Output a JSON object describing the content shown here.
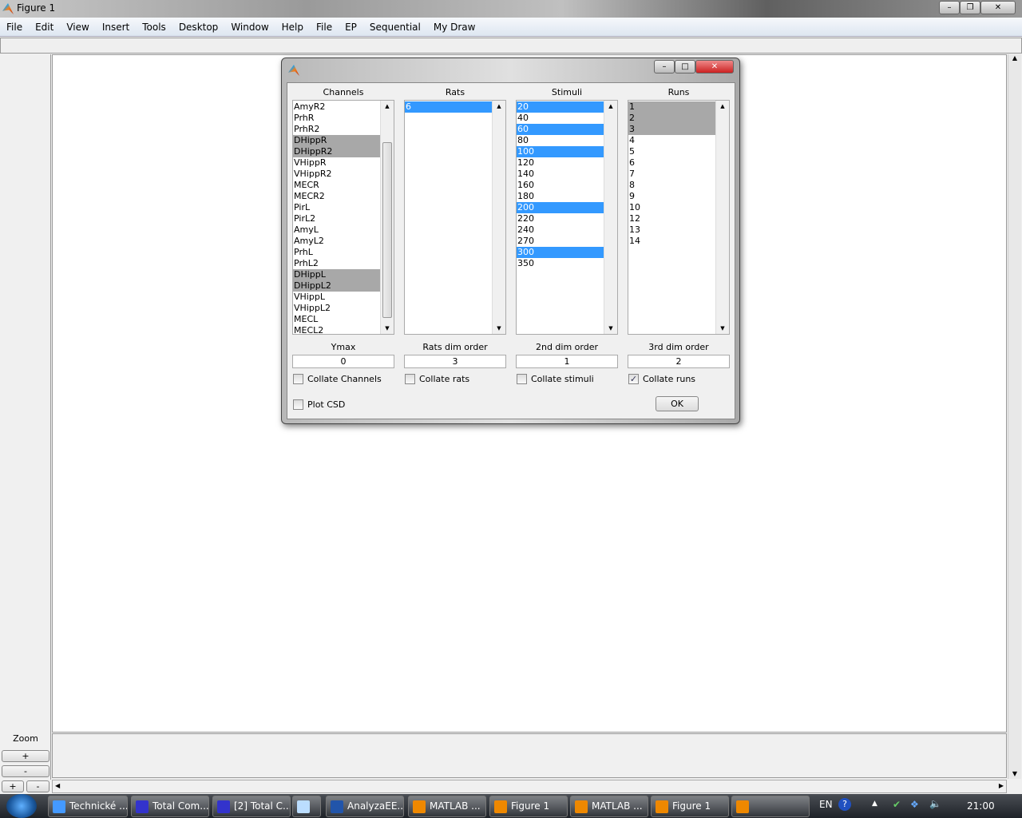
{
  "window": {
    "title": "Figure 1"
  },
  "menu": [
    "File",
    "Edit",
    "View",
    "Insert",
    "Tools",
    "Desktop",
    "Window",
    "Help",
    "File",
    "EP",
    "Sequential",
    "My Draw"
  ],
  "zoom_panel": {
    "label": "Zoom",
    "plus": "+",
    "minus": "-",
    "plus2": "+",
    "minus2": "-"
  },
  "dialog": {
    "lists": [
      {
        "label": "Channels",
        "items": [
          "AmyR2",
          "PrhR",
          "PrhR2",
          "DHippR",
          "DHippR2",
          "VHippR",
          "VHippR2",
          "MECR",
          "MECR2",
          "PirL",
          "PirL2",
          "AmyL",
          "AmyL2",
          "PrhL",
          "PrhL2",
          "DHippL",
          "DHippL2",
          "VHippL",
          "VHippL2",
          "MECL",
          "MECL2"
        ],
        "selected": [
          "DHippR",
          "DHippR2",
          "DHippL",
          "DHippL2"
        ],
        "selection_style": "inactive"
      },
      {
        "label": "Rats",
        "items": [
          "6"
        ],
        "selected": [
          "6"
        ],
        "selection_style": "active"
      },
      {
        "label": "Stimuli",
        "items": [
          "20",
          "40",
          "60",
          "80",
          "100",
          "120",
          "140",
          "160",
          "180",
          "200",
          "220",
          "240",
          "270",
          "300",
          "350"
        ],
        "selected": [
          "20",
          "60",
          "100",
          "200",
          "300"
        ],
        "selection_style": "active"
      },
      {
        "label": "Runs",
        "items": [
          "1",
          "2",
          "3",
          "4",
          "5",
          "6",
          "7",
          "8",
          "9",
          "10",
          "12",
          "13",
          "14"
        ],
        "selected": [
          "1",
          "2",
          "3"
        ],
        "selection_style": "inactive"
      }
    ],
    "fields": [
      {
        "label": "Ymax",
        "value": "0"
      },
      {
        "label": "Rats dim order",
        "value": "3"
      },
      {
        "label": "2nd dim order",
        "value": "1"
      },
      {
        "label": "3rd dim order",
        "value": "2"
      }
    ],
    "checkboxes": [
      {
        "label": "Collate Channels",
        "checked": false
      },
      {
        "label": "Collate rats",
        "checked": false
      },
      {
        "label": "Collate stimuli",
        "checked": false
      },
      {
        "label": "Collate runs",
        "checked": true
      }
    ],
    "plot_csd": {
      "label": "Plot CSD",
      "checked": false
    },
    "ok": "OK",
    "colors": {
      "active_selection": "#3399ff",
      "inactive_selection": "#a8a8a8"
    }
  },
  "taskbar": {
    "items": [
      {
        "label": "Technické ...",
        "icon": "ie-icon"
      },
      {
        "label": "Total Com...",
        "icon": "floppy-icon"
      },
      {
        "label": "[2] Total C...",
        "icon": "floppy-icon"
      },
      {
        "label": "",
        "icon": "notepad-icon"
      },
      {
        "label": "AnalyzaEE...",
        "icon": "word-icon"
      },
      {
        "label": "MATLAB ...",
        "icon": "matlab-icon"
      },
      {
        "label": "Figure 1",
        "icon": "matlab-icon"
      },
      {
        "label": "MATLAB ...",
        "icon": "matlab-icon"
      },
      {
        "label": "Figure 1",
        "icon": "matlab-icon"
      },
      {
        "label": "",
        "icon": "matlab-icon"
      }
    ],
    "lang": "EN",
    "clock": "21:00"
  }
}
